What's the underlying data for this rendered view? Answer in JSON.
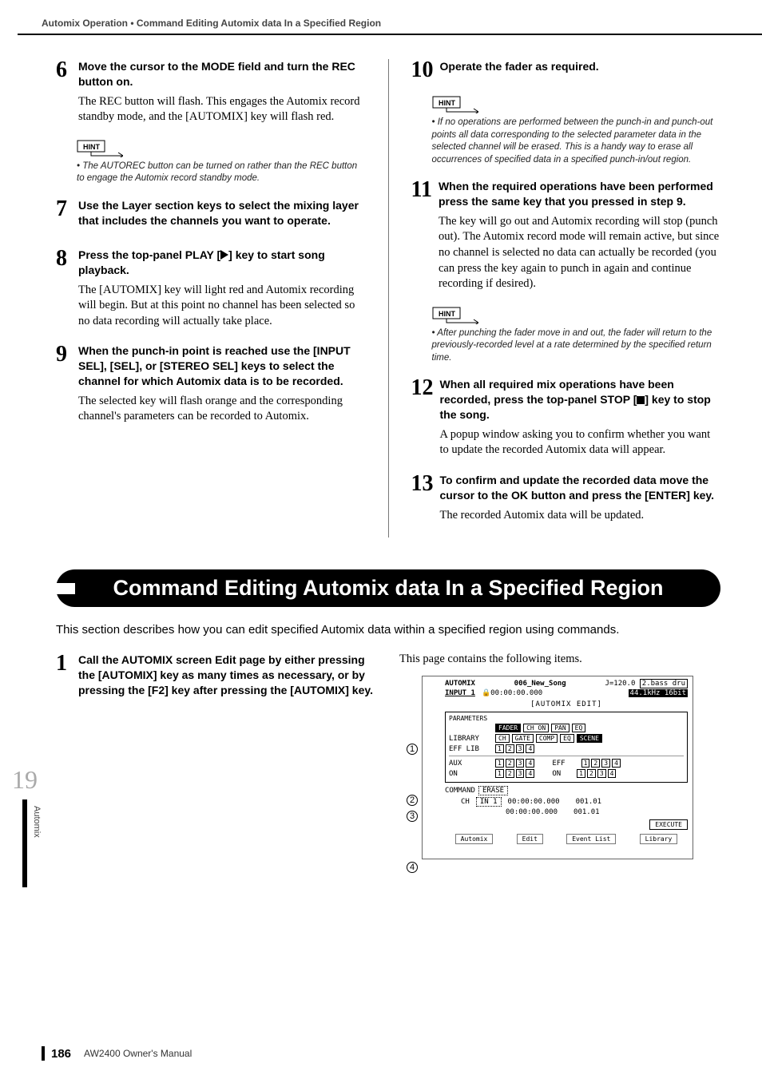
{
  "header": {
    "breadcrumb": "Automix Operation  •  Command Editing Automix data In a Specified Region"
  },
  "steps_left": [
    {
      "num": "6",
      "title": "Move the cursor to the MODE field and turn the REC button on.",
      "desc": "The REC button will flash. This engages the Automix record standby mode, and the [AUTOMIX] key will flash red."
    },
    {
      "num": "7",
      "title": "Use the Layer section keys to select the mixing layer that includes the channels you want to operate.",
      "desc": ""
    },
    {
      "num": "8",
      "title": "Press the top-panel PLAY [▶] key to start song playback.",
      "title_pre": "Press the top-panel PLAY [",
      "title_post": "] key to start song playback.",
      "desc": "The [AUTOMIX] key will light red and Automix recording will begin. But at this point no channel has been selected so no data recording will actually take place."
    },
    {
      "num": "9",
      "title": "When the punch-in point is reached use the [INPUT SEL], [SEL], or [STEREO SEL] keys to select the channel for which Automix data is to be recorded.",
      "desc": "The selected key will flash orange and the corresponding channel's parameters can be recorded to Automix."
    }
  ],
  "hint_left": "The AUTOREC button can be turned on rather than the REC button to engage the Automix record standby mode.",
  "steps_right": [
    {
      "num": "10",
      "title": "Operate the fader as required.",
      "desc": ""
    },
    {
      "num": "11",
      "title": "When the required operations have been performed press the same key that you pressed in step 9.",
      "desc": "The key will go out and Automix recording will stop (punch out). The Automix record mode will remain active, but since no channel is selected no data can actually be recorded (you can press the key again to punch in again and continue recording if desired)."
    },
    {
      "num": "12",
      "title_pre": "When all required mix operations have been recorded, press the top-panel STOP [",
      "title_post": "] key to stop the song.",
      "desc": "A popup window asking you to confirm whether you want to update the recorded Automix data will appear."
    },
    {
      "num": "13",
      "title": "To confirm and update the recorded data move the cursor to the OK button and press the [ENTER] key.",
      "desc": "The recorded Automix data will be updated."
    }
  ],
  "hint_right_1": "If no operations are performed between the punch-in and punch-out points all data corresponding to the selected parameter data in the selected channel will be erased. This is a handy way to erase all occurrences of specified data in a specified punch-in/out region.",
  "hint_right_2": "After punching the fader move in and out, the fader will return to the previously-recorded level at a rate determined by the specified return time.",
  "section": {
    "title": "Command Editing Automix data In a Specified Region",
    "intro": "This section describes how you can edit specified Automix data within a specified region using commands."
  },
  "step_bottom": {
    "num": "1",
    "title": "Call the AUTOMIX screen Edit page by either pressing the [AUTOMIX] key as many times as necessary, or by pressing the [F2] key after pressing the [AUTOMIX] key."
  },
  "right_bottom_text": "This page contains the following items.",
  "hint_label": "HINT",
  "screenshot": {
    "title_l": "AUTOMIX",
    "title_r": "006_New_Song",
    "tempo": "J=120.0",
    "bar": "2.bass dru",
    "input": "INPUT 1",
    "time": "00:00:00.000",
    "rate": "44.1kHz 16bit",
    "sub_title": "AUTOMIX EDIT",
    "parameters": "PARAMETERS",
    "row1": [
      "FADER",
      "CH ON",
      "PAN",
      "EQ"
    ],
    "library": "LIBRARY",
    "row2": [
      "CH",
      "GATE",
      "COMP",
      "EQ",
      "SCENE"
    ],
    "efflib": "EFF LIB",
    "aux": "AUX",
    "on": "ON",
    "eff": "EFF",
    "command": "COMMAND",
    "erase": "ERASE",
    "ch": "CH",
    "in1": "IN 1",
    "tc1": "00:00:00.000",
    "tc2": "00:00:00.000",
    "m1": "001.01",
    "m2": "001.01",
    "execute": "EXECUTE",
    "tabs": [
      "Automix",
      "Edit",
      "Event List",
      "Library"
    ]
  },
  "sidebar": {
    "chapter": "19",
    "label": "Automix"
  },
  "footer": {
    "page": "186",
    "doc": "AW2400  Owner's Manual"
  }
}
